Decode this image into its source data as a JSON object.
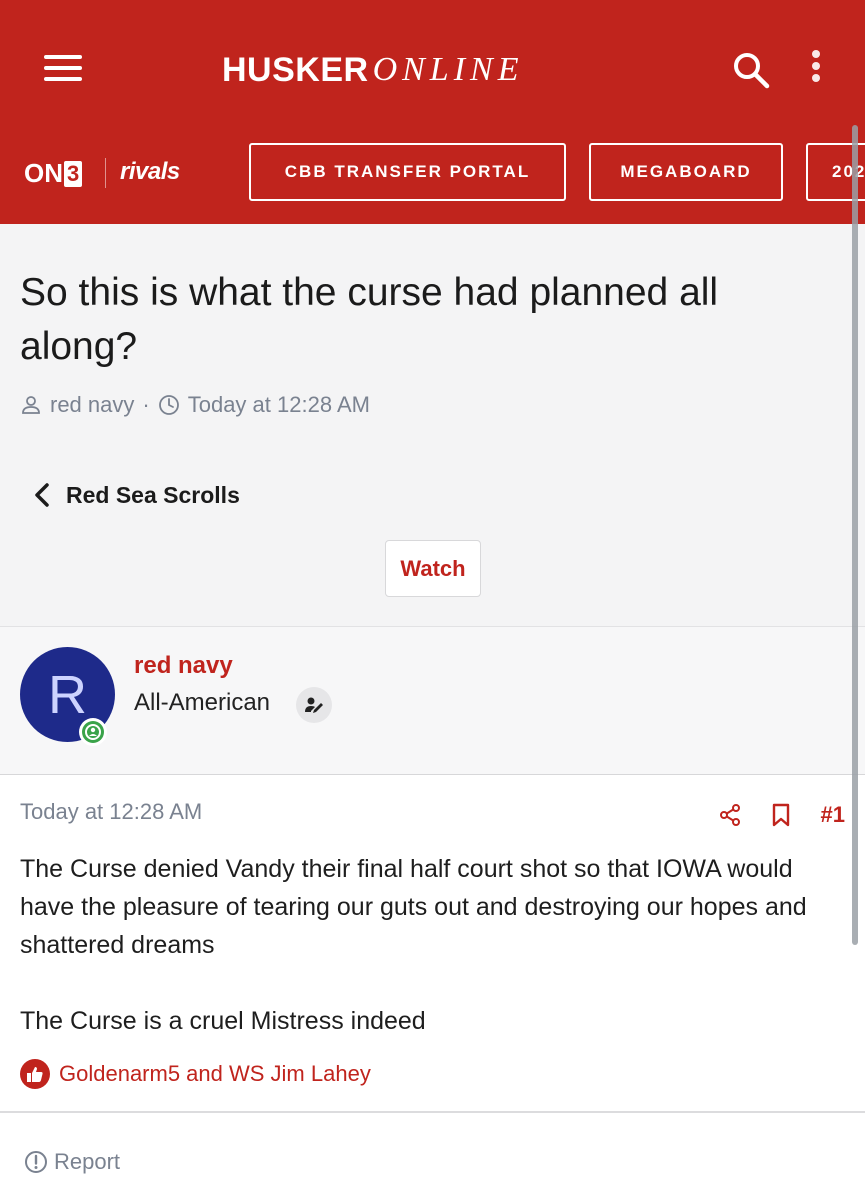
{
  "header": {
    "logo_bold": "HUSKER",
    "logo_italic": "ONLINE",
    "brand_color": "#c0241d"
  },
  "nav": {
    "brand_on3_text": "ON",
    "brand_on3_num": "3",
    "brand_rivals": "rivals",
    "pills": [
      {
        "label": "CBB TRANSFER PORTAL"
      },
      {
        "label": "MEGABOARD"
      },
      {
        "label": "202"
      }
    ]
  },
  "thread": {
    "title": "So this is what the curse had planned all along?",
    "author": "red navy",
    "meta_separator": "·",
    "time": "Today at 12:28 AM",
    "forum": "Red Sea Scrolls",
    "watch_label": "Watch"
  },
  "post": {
    "avatar_letter": "R",
    "avatar_color": "#1e2a8a",
    "username": "red navy",
    "rank": "All-American",
    "date": "Today at 12:28 AM",
    "number": "#1",
    "paragraphs": [
      "The Curse denied Vandy their final half court shot so that IOWA would have the pleasure of tearing our guts out and destroying our hopes and shattered dreams",
      "The Curse is a cruel Mistress indeed"
    ],
    "reactions_text": "Goldenarm5 and WS Jim Lahey",
    "report_label": "Report"
  },
  "icons": {
    "menu": "menu-icon",
    "search": "search-icon",
    "more": "more-vertical-icon",
    "user": "user-icon",
    "clock": "clock-icon",
    "back": "chevron-left-icon",
    "online": "online-status-icon",
    "rank": "user-edit-icon",
    "share": "share-icon",
    "bookmark": "bookmark-icon",
    "like": "thumbs-up-icon",
    "report": "alert-circle-icon"
  }
}
